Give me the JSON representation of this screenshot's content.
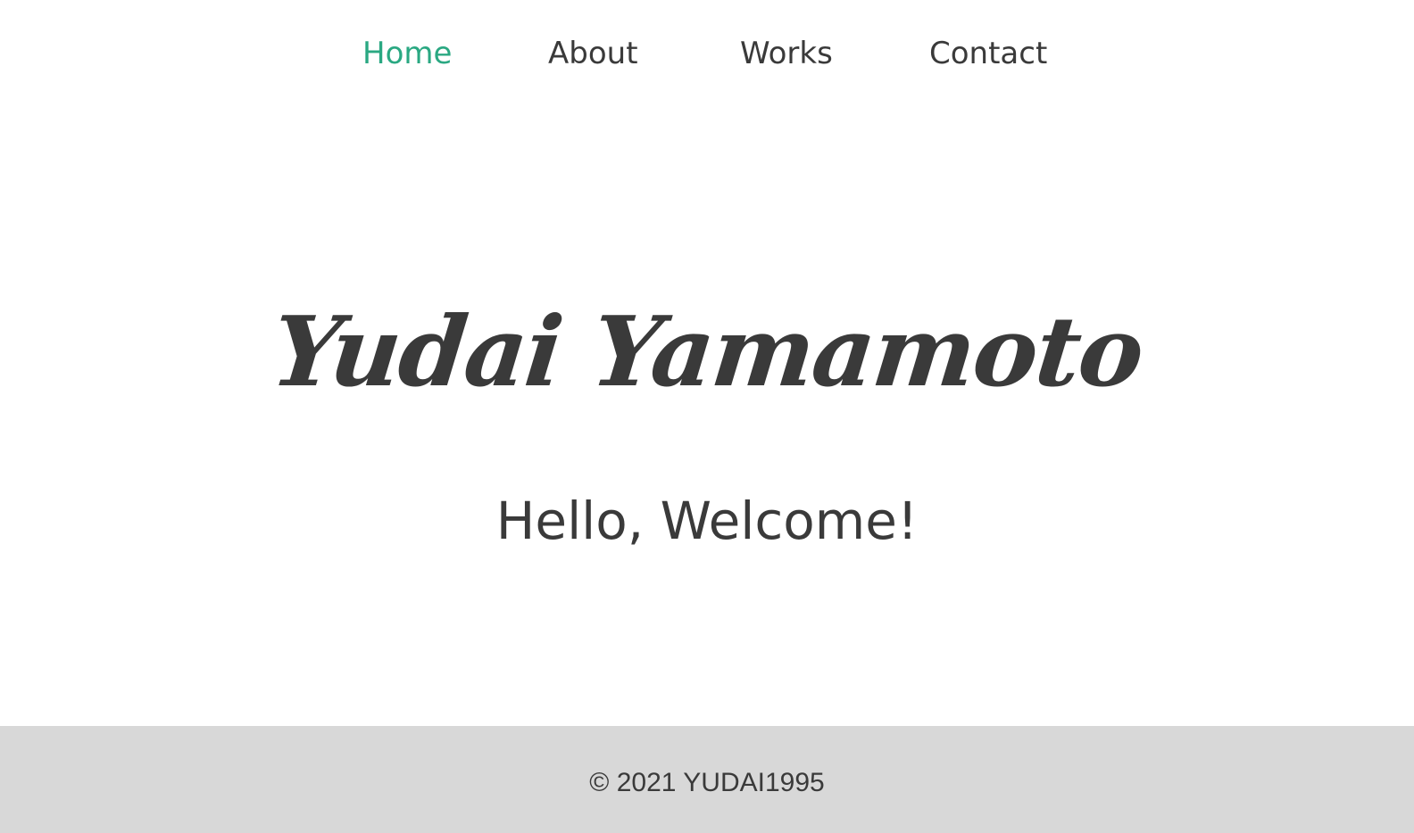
{
  "nav": {
    "items": [
      {
        "label": "Home",
        "active": true
      },
      {
        "label": "About",
        "active": false
      },
      {
        "label": "Works",
        "active": false
      },
      {
        "label": "Contact",
        "active": false
      }
    ]
  },
  "hero": {
    "name": "Yudai Yamamoto",
    "greeting": "Hello, Welcome!"
  },
  "footer": {
    "copyright": "© 2021 YUDAI1995"
  },
  "colors": {
    "accent": "#2aa882",
    "text": "#3a3a3a",
    "footer_bg": "#d8d8d8",
    "background": "#ffffff"
  }
}
